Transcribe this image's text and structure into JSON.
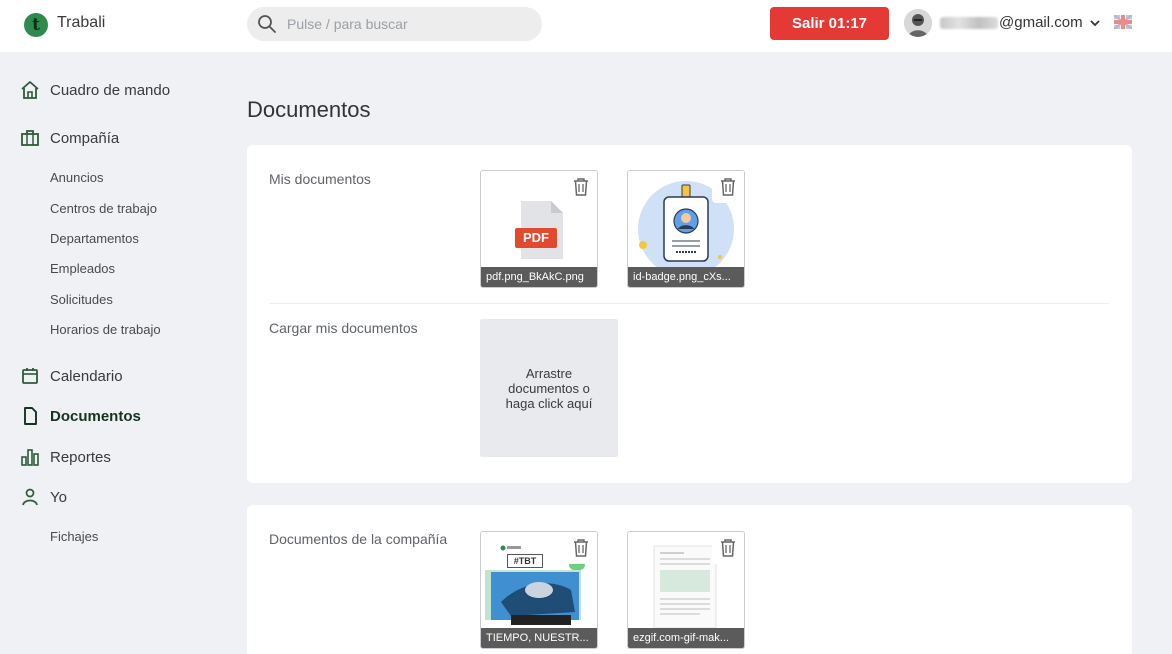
{
  "header": {
    "app_name": "Trabali",
    "logo_letter": "t",
    "search_placeholder": "Pulse / para buscar",
    "logout_label": "Salir 01:17",
    "email_suffix": "@gmail.com",
    "brand_color": "#2f8a4e",
    "logout_color": "#e53935"
  },
  "sidebar": {
    "items": [
      {
        "label": "Cuadro de mando",
        "icon": "home-icon"
      },
      {
        "label": "Compañía",
        "icon": "briefcase-icon"
      },
      {
        "label": "Calendario",
        "icon": "calendar-icon"
      },
      {
        "label": "Documentos",
        "icon": "document-icon"
      },
      {
        "label": "Reportes",
        "icon": "bar-chart-icon"
      },
      {
        "label": "Yo",
        "icon": "user-icon"
      }
    ],
    "company_sub": [
      "Anuncios",
      "Centros de trabajo",
      "Departamentos",
      "Empleados",
      "Solicitudes",
      "Horarios de trabajo"
    ],
    "me_sub": [
      "Fichajes"
    ]
  },
  "main": {
    "title": "Documentos",
    "my_docs_label": "Mis documentos",
    "my_docs": [
      {
        "name": "pdf.png_BkAkC.png",
        "badge": "PDF"
      },
      {
        "name": "id-badge.png_cXs..."
      }
    ],
    "upload_label": "Cargar mis documentos",
    "upload_hint": "Arrastre documentos o haga click aquí",
    "company_docs_label": "Documentos de la compañía",
    "company_docs": [
      {
        "name": "TIEMPO, NUESTR...",
        "thumb_tag": "#TBT"
      },
      {
        "name": "ezgif.com-gif-mak..."
      }
    ]
  }
}
